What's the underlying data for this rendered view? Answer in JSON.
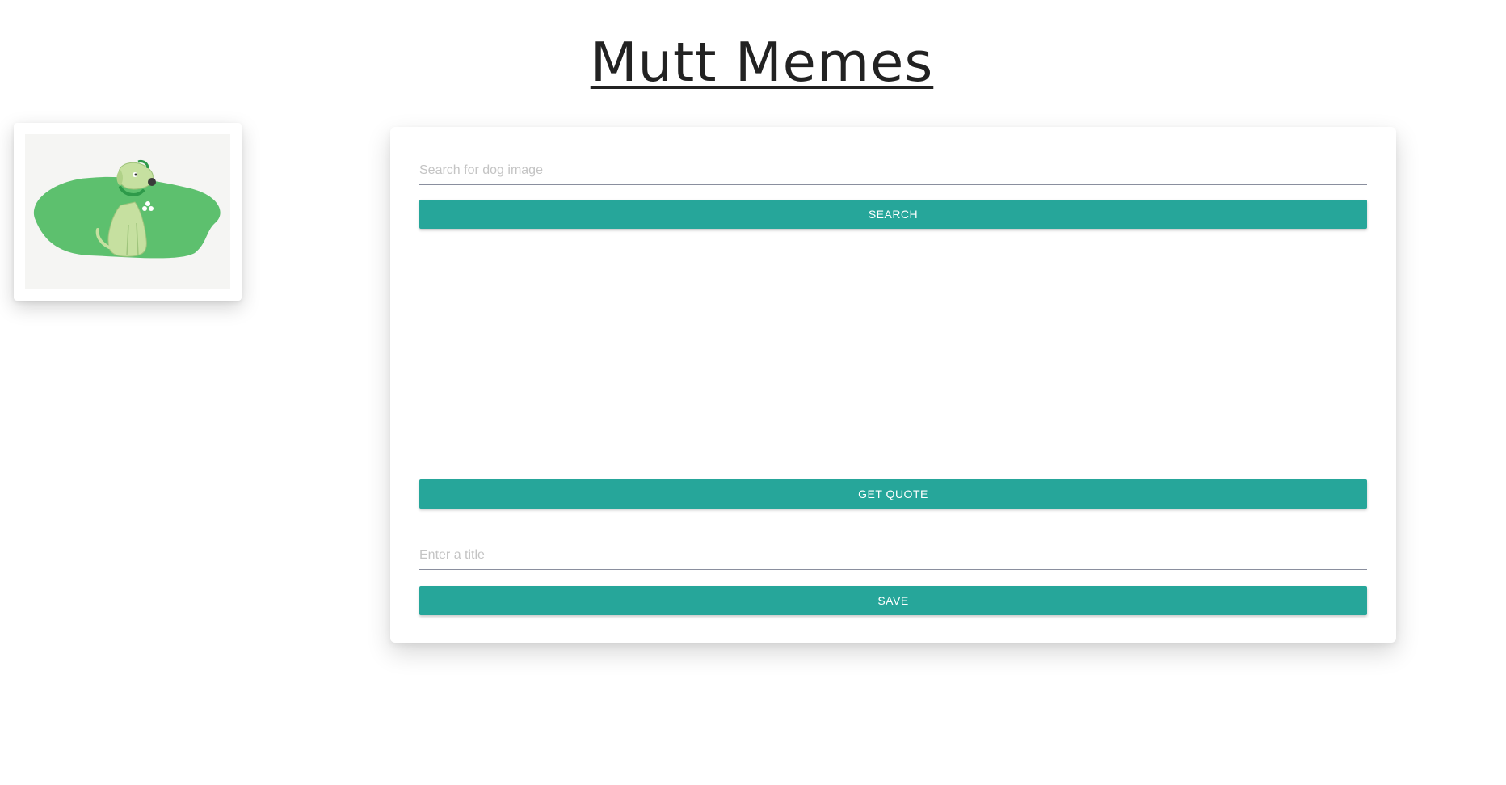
{
  "header": {
    "title": "Mutt Memes"
  },
  "logo": {
    "icon": "dog-on-grass-illustration",
    "colors": {
      "grass": "#5dc06e",
      "dog": "#c6e0a0",
      "collar": "#2e9a4a",
      "background": "#f5f5f3"
    }
  },
  "search": {
    "placeholder": "Search for dog image",
    "value": "",
    "button_label": "SEARCH"
  },
  "quote": {
    "button_label": "GET QUOTE"
  },
  "title_input": {
    "placeholder": "Enter a title",
    "value": "",
    "button_label": "SAVE"
  },
  "colors": {
    "accent": "#26a69a",
    "title_text": "#222222"
  }
}
